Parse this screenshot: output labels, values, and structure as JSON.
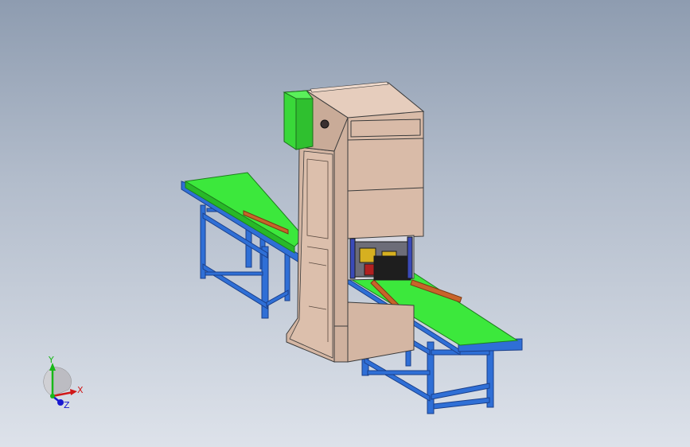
{
  "triad": {
    "x_label": "X",
    "y_label": "Y",
    "z_label": "Z"
  },
  "colors": {
    "belt": "#3ce83c",
    "frame": "#2f6fd6",
    "cabinet_front": "#d9bba8",
    "cabinet_side": "#cdb09d",
    "cabinet_top": "#e6cdbd",
    "control_box": "#39d839",
    "guide_rail": "#c8642a",
    "mechanism": "#2a2a2a"
  },
  "icons": {
    "triad": "axis-triad-icon"
  }
}
